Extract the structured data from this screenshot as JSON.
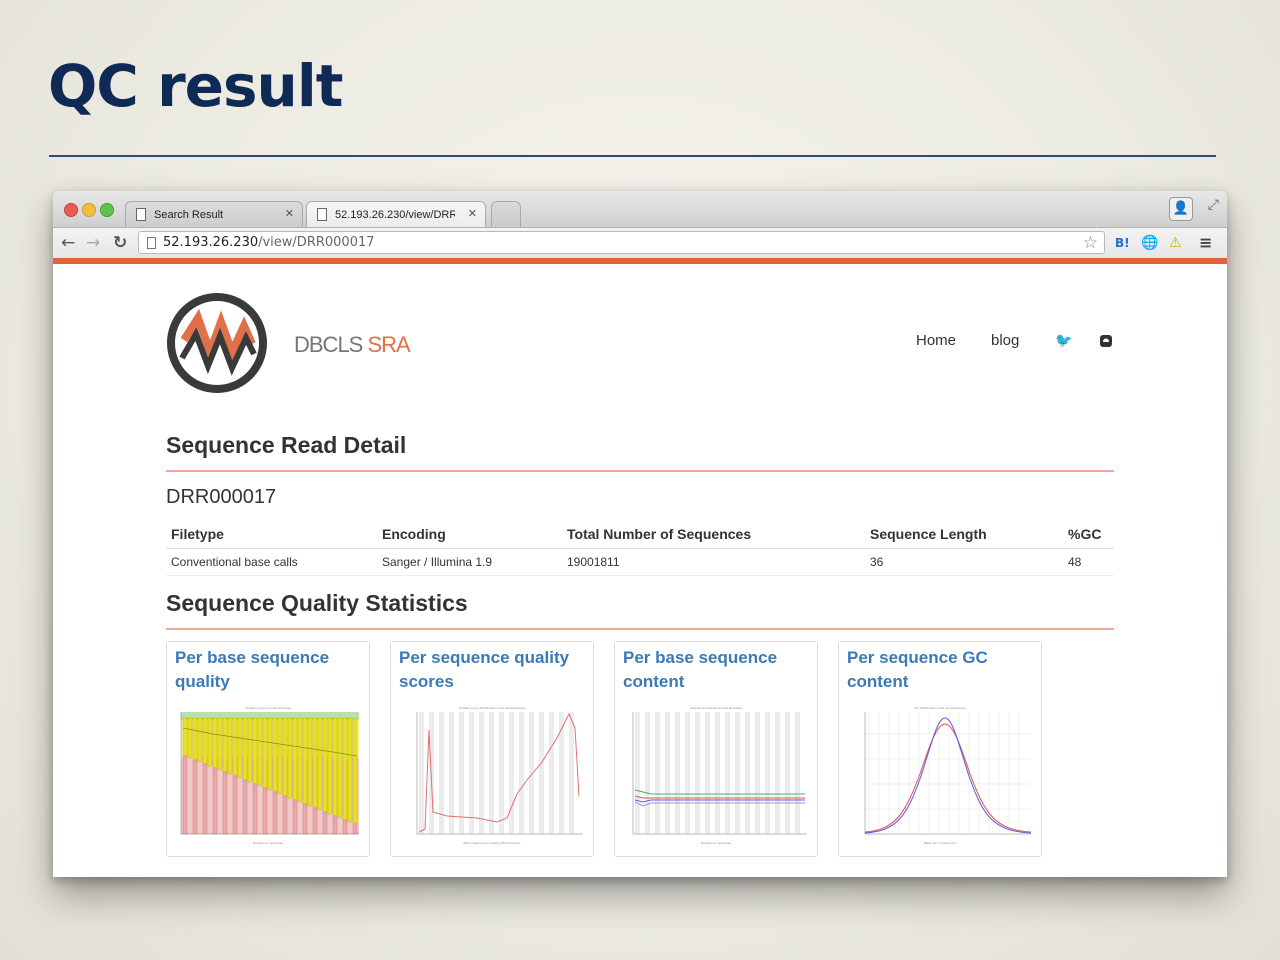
{
  "slide": {
    "title": "QC result"
  },
  "browser": {
    "tabs": [
      {
        "label": "Search Result"
      },
      {
        "label": "52.193.26.230/view/DRR000017"
      }
    ],
    "url_host": "52.193.26.230",
    "url_path": "/view/DRR000017",
    "extensions": {
      "hatena": "B!"
    }
  },
  "site": {
    "brand_primary": "DBCLS",
    "brand_secondary": "SRA",
    "nav": {
      "home": "Home",
      "blog": "blog"
    }
  },
  "detail": {
    "heading": "Sequence Read Detail",
    "run_id": "DRR000017",
    "columns": [
      "Filetype",
      "Encoding",
      "Total Number of Sequences",
      "Sequence Length",
      "%GC"
    ],
    "row": [
      "Conventional base calls",
      "Sanger / Illumina 1.9",
      "19001811",
      "36",
      "48"
    ]
  },
  "quality": {
    "heading": "Sequence Quality Statistics",
    "cards": [
      {
        "title": "Per base sequence quality"
      },
      {
        "title": "Per sequence quality scores"
      },
      {
        "title": "Per base sequence content"
      },
      {
        "title": "Per sequence GC content"
      }
    ]
  },
  "colors": {
    "slide_title": "#0f2a55",
    "accent_orange": "#e0663a",
    "card_link": "#3a7ab8",
    "heading_rule": "#f0a898"
  }
}
